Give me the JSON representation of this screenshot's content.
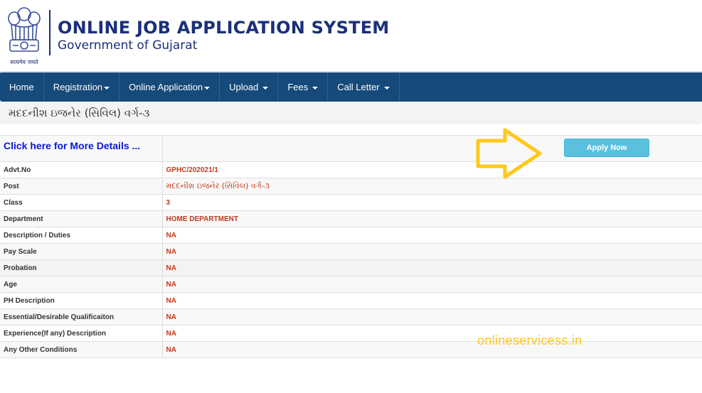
{
  "header": {
    "title": "ONLINE JOB APPLICATION SYSTEM",
    "subtitle": "Government of Gujarat",
    "emblem_motto": "सत्यमेव जयते",
    "emblem_icon": "national-emblem-icon"
  },
  "nav": {
    "items": [
      {
        "label": "Home",
        "dropdown": false
      },
      {
        "label": "Registration",
        "dropdown": true
      },
      {
        "label": "Online Application",
        "dropdown": true
      },
      {
        "label": "Upload",
        "dropdown": true
      },
      {
        "label": "Fees",
        "dropdown": true
      },
      {
        "label": "Call Letter",
        "dropdown": true
      }
    ]
  },
  "post_bar": {
    "title": "મદદનીશ ઇજનેર (સિવિલ) વર્ગ-૩"
  },
  "details": {
    "more_link": "Click here for More Details ...",
    "apply_button": "Apply Now",
    "rows": [
      {
        "label": "Advt.No",
        "value": "GPHC/202021/1"
      },
      {
        "label": "Post",
        "value": "મદદનીશ ઇજનેર (સિવિલ) વર્ગ-૩"
      },
      {
        "label": "Class",
        "value": "3"
      },
      {
        "label": "Department",
        "value": "HOME DEPARTMENT"
      },
      {
        "label": "Description / Duties",
        "value": "NA"
      },
      {
        "label": "Pay Scale",
        "value": "NA"
      },
      {
        "label": "Probation",
        "value": "NA"
      },
      {
        "label": "Age",
        "value": "NA"
      },
      {
        "label": "PH Description",
        "value": "NA"
      },
      {
        "label": "Essential/Desirable Qualificaiton",
        "value": "NA"
      },
      {
        "label": "Experience(If any) Description",
        "value": "NA"
      },
      {
        "label": "Any Other Conditions",
        "value": "NA"
      }
    ]
  },
  "annotation": {
    "arrow_icon": "right-arrow-outline-icon",
    "watermark": "onlineservicess.in"
  },
  "colors": {
    "nav_bg": "#164a7a",
    "title_blue": "#1b2f7a",
    "value_red": "#c0391b",
    "link_blue": "#0a17d9",
    "button_info": "#5bc0de",
    "annotation_yellow": "#ffc81a"
  }
}
